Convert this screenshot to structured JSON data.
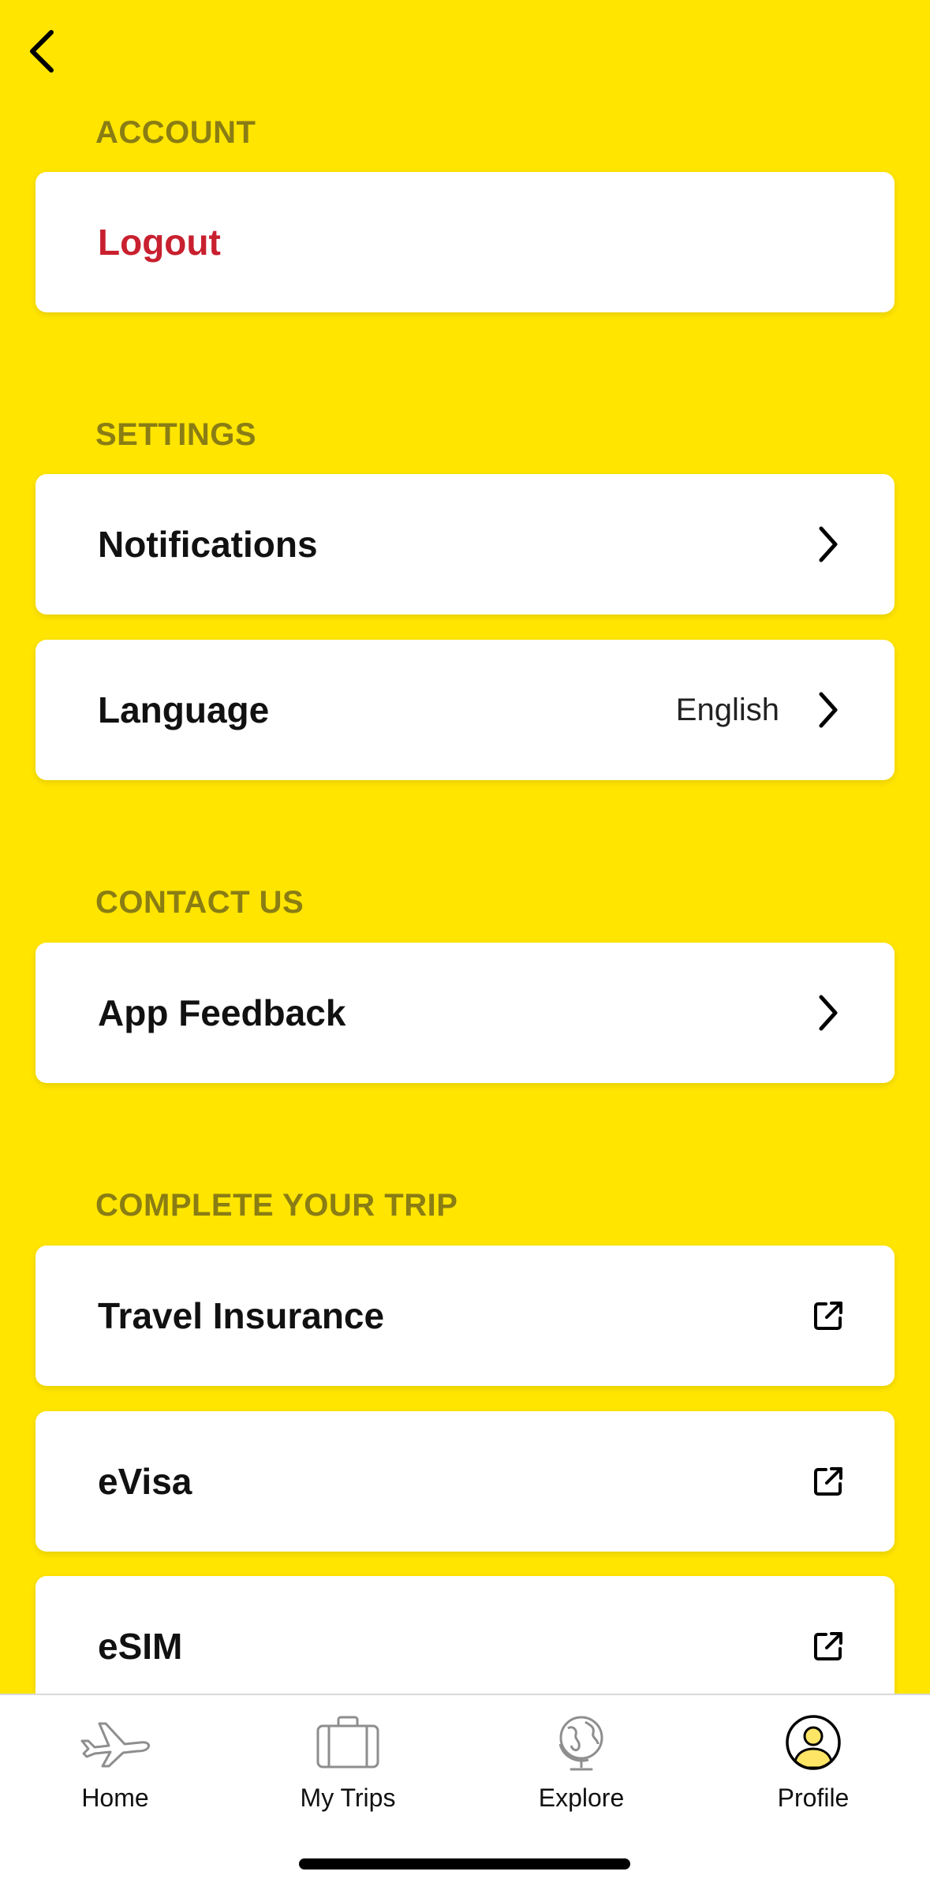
{
  "theme": {
    "background": "#FFE500",
    "section_header_color": "#8A7D14",
    "danger_color": "#C8202F",
    "card_background": "#FFFFFF"
  },
  "nav": {
    "back_icon": "chevron-left-icon"
  },
  "sections": {
    "account": {
      "title": "ACCOUNT",
      "logout": "Logout"
    },
    "settings": {
      "title": "SETTINGS",
      "notifications": "Notifications",
      "language": "Language",
      "language_value": "English"
    },
    "contact": {
      "title": "CONTACT US",
      "app_feedback": "App Feedback"
    },
    "trip": {
      "title": "COMPLETE YOUR TRIP",
      "travel_insurance": "Travel Insurance",
      "evisa": "eVisa",
      "esim": "eSIM"
    }
  },
  "tabs": {
    "home": {
      "label": "Home",
      "icon": "airplane-icon"
    },
    "my_trips": {
      "label": "My Trips",
      "icon": "suitcase-icon"
    },
    "explore": {
      "label": "Explore",
      "icon": "globe-icon"
    },
    "profile": {
      "label": "Profile",
      "icon": "profile-icon",
      "active": true
    }
  }
}
